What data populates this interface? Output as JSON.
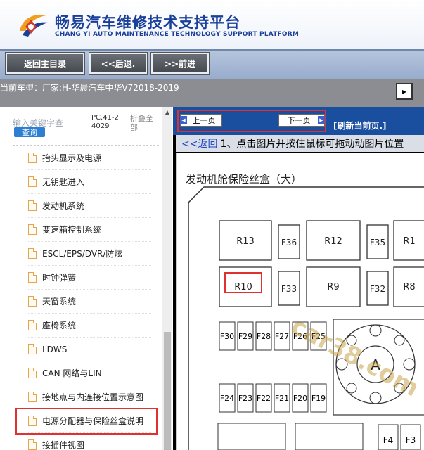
{
  "header": {
    "brand_cn": "畅易汽车维修技术支持平台",
    "brand_en": "CHANG YI AUTO MAINTENANCE TECHNOLOGY SUPPORT PLATFORM"
  },
  "nav": {
    "home": "返回主目录",
    "back": "<<后退.",
    "forward": ">>前进"
  },
  "car": {
    "label": "当前车型：厂家:H-华晨汽车中华V72018-2019",
    "toggle_glyph": "▸"
  },
  "sidebar": {
    "search_placeholder": "输入关键字查",
    "search_button": "查询",
    "code": "PC.41-24029",
    "collapse": "折叠全部",
    "items": [
      {
        "label": "抬头显示及电源"
      },
      {
        "label": "无钥匙进入"
      },
      {
        "label": "发动机系统"
      },
      {
        "label": "变速箱控制系统"
      },
      {
        "label": "ESCL/EPS/DVR/防炫"
      },
      {
        "label": "时钟弹簧"
      },
      {
        "label": "天窗系统"
      },
      {
        "label": "座椅系统"
      },
      {
        "label": "LDWS"
      },
      {
        "label": "CAN 网络与LIN"
      },
      {
        "label": "接地点与内连接位置示意图"
      },
      {
        "label": "电源分配器与保险丝盒说明"
      },
      {
        "label": "接插件视图"
      }
    ]
  },
  "content": {
    "prev_page": "上一页",
    "next_page": "下一页",
    "refresh": "[刷新当前页.]",
    "back_link": "<<返回",
    "instruction": "1、点击图片并按住鼠标可拖动动图片位置",
    "diagram_title": "发动机舱保险丝盒（大）",
    "relays": {
      "r13": "R13",
      "r12": "R12",
      "r1": "R1",
      "r10": "R10",
      "r9": "R9",
      "r8": "R8"
    },
    "fuses_top": {
      "f36": "F36",
      "f35": "F35",
      "f33": "F33",
      "f32": "F32"
    },
    "fuse_row1": [
      "F30",
      "F29",
      "F28",
      "F27",
      "F26",
      "F25"
    ],
    "fuse_row2": [
      "F24",
      "F23",
      "F22",
      "F21",
      "F20",
      "F19"
    ],
    "fuses_bottom": {
      "f4": "F4",
      "f3": "F3"
    },
    "circle_label": "A",
    "watermark": "car38.com"
  },
  "colors": {
    "brand": "#1a3f9a",
    "highlight": "#e03030",
    "content_header": "#1a4fa0"
  }
}
